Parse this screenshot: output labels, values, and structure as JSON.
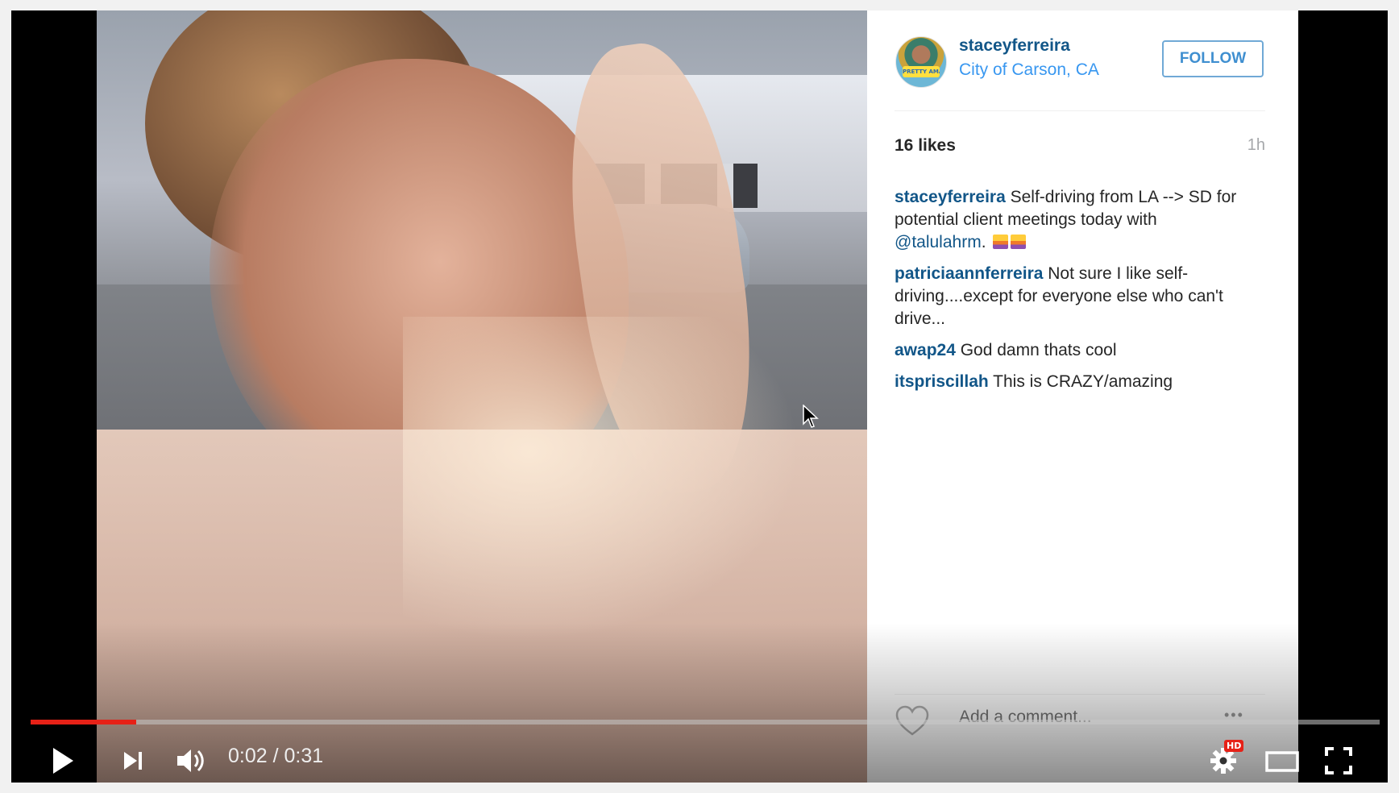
{
  "post": {
    "username": "staceyferreira",
    "location": "City of Carson, CA",
    "follow_label": "FOLLOW",
    "likes": "16 likes",
    "time": "1h",
    "avatar_text": "PRETTY AMAZING INVENT"
  },
  "comments": [
    {
      "user": "staceyferreira",
      "text": " Self-driving from LA --> SD for potential client meetings today with ",
      "mention": "@talulahrm",
      "tail": "."
    },
    {
      "user": "patriciaannferreira",
      "text": " Not sure I like self-driving....except for everyone else who can't drive..."
    },
    {
      "user": "awap24",
      "text": " God damn thats cool"
    },
    {
      "user": "itspriscillah",
      "text": " This is CRAZY/amazing"
    }
  ],
  "comment_box": {
    "placeholder": "Add a comment..."
  },
  "player": {
    "time_display": "0:02 / 0:31",
    "progress": 0.078,
    "hd_label": "HD"
  },
  "colors": {
    "accent_red": "#e62117",
    "link_blue": "#125688",
    "location_blue": "#3897f0"
  }
}
